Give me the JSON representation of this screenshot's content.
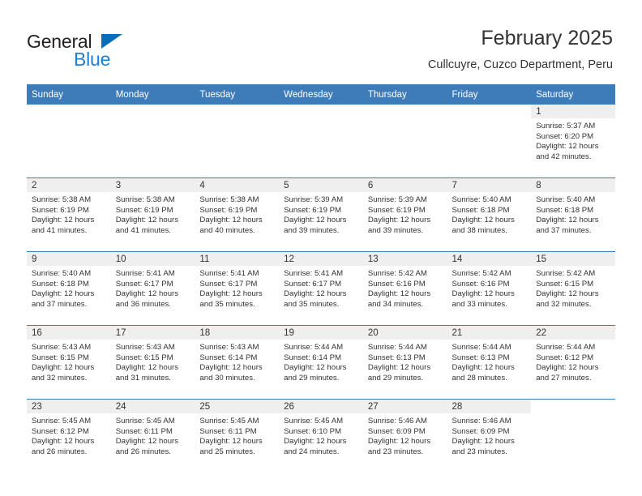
{
  "brand": {
    "name_top": "General",
    "name_bottom": "Blue",
    "triangle_color": "#0b6cb7",
    "blue_text_color": "#1b7fd4"
  },
  "header": {
    "title": "February 2025",
    "subtitle": "Cullcuyre, Cuzco Department, Peru"
  },
  "theme": {
    "header_bg": "#3e7cb9",
    "header_text": "#ffffff",
    "daynum_band_bg": "#efefef",
    "row_divider": "#3e7cb9",
    "body_text": "#333333"
  },
  "calendar": {
    "weekdays": [
      "Sunday",
      "Monday",
      "Tuesday",
      "Wednesday",
      "Thursday",
      "Friday",
      "Saturday"
    ],
    "labels": {
      "sunrise": "Sunrise:",
      "sunset": "Sunset:",
      "daylight": "Daylight:"
    },
    "weeks": [
      [
        {
          "day": "",
          "sunrise": "",
          "sunset": "",
          "daylight_line1": "",
          "daylight_line2": ""
        },
        {
          "day": "",
          "sunrise": "",
          "sunset": "",
          "daylight_line1": "",
          "daylight_line2": ""
        },
        {
          "day": "",
          "sunrise": "",
          "sunset": "",
          "daylight_line1": "",
          "daylight_line2": ""
        },
        {
          "day": "",
          "sunrise": "",
          "sunset": "",
          "daylight_line1": "",
          "daylight_line2": ""
        },
        {
          "day": "",
          "sunrise": "",
          "sunset": "",
          "daylight_line1": "",
          "daylight_line2": ""
        },
        {
          "day": "",
          "sunrise": "",
          "sunset": "",
          "daylight_line1": "",
          "daylight_line2": ""
        },
        {
          "day": "1",
          "sunrise": "Sunrise: 5:37 AM",
          "sunset": "Sunset: 6:20 PM",
          "daylight_line1": "Daylight: 12 hours",
          "daylight_line2": "and 42 minutes."
        }
      ],
      [
        {
          "day": "2",
          "sunrise": "Sunrise: 5:38 AM",
          "sunset": "Sunset: 6:19 PM",
          "daylight_line1": "Daylight: 12 hours",
          "daylight_line2": "and 41 minutes."
        },
        {
          "day": "3",
          "sunrise": "Sunrise: 5:38 AM",
          "sunset": "Sunset: 6:19 PM",
          "daylight_line1": "Daylight: 12 hours",
          "daylight_line2": "and 41 minutes."
        },
        {
          "day": "4",
          "sunrise": "Sunrise: 5:38 AM",
          "sunset": "Sunset: 6:19 PM",
          "daylight_line1": "Daylight: 12 hours",
          "daylight_line2": "and 40 minutes."
        },
        {
          "day": "5",
          "sunrise": "Sunrise: 5:39 AM",
          "sunset": "Sunset: 6:19 PM",
          "daylight_line1": "Daylight: 12 hours",
          "daylight_line2": "and 39 minutes."
        },
        {
          "day": "6",
          "sunrise": "Sunrise: 5:39 AM",
          "sunset": "Sunset: 6:19 PM",
          "daylight_line1": "Daylight: 12 hours",
          "daylight_line2": "and 39 minutes."
        },
        {
          "day": "7",
          "sunrise": "Sunrise: 5:40 AM",
          "sunset": "Sunset: 6:18 PM",
          "daylight_line1": "Daylight: 12 hours",
          "daylight_line2": "and 38 minutes."
        },
        {
          "day": "8",
          "sunrise": "Sunrise: 5:40 AM",
          "sunset": "Sunset: 6:18 PM",
          "daylight_line1": "Daylight: 12 hours",
          "daylight_line2": "and 37 minutes."
        }
      ],
      [
        {
          "day": "9",
          "sunrise": "Sunrise: 5:40 AM",
          "sunset": "Sunset: 6:18 PM",
          "daylight_line1": "Daylight: 12 hours",
          "daylight_line2": "and 37 minutes."
        },
        {
          "day": "10",
          "sunrise": "Sunrise: 5:41 AM",
          "sunset": "Sunset: 6:17 PM",
          "daylight_line1": "Daylight: 12 hours",
          "daylight_line2": "and 36 minutes."
        },
        {
          "day": "11",
          "sunrise": "Sunrise: 5:41 AM",
          "sunset": "Sunset: 6:17 PM",
          "daylight_line1": "Daylight: 12 hours",
          "daylight_line2": "and 35 minutes."
        },
        {
          "day": "12",
          "sunrise": "Sunrise: 5:41 AM",
          "sunset": "Sunset: 6:17 PM",
          "daylight_line1": "Daylight: 12 hours",
          "daylight_line2": "and 35 minutes."
        },
        {
          "day": "13",
          "sunrise": "Sunrise: 5:42 AM",
          "sunset": "Sunset: 6:16 PM",
          "daylight_line1": "Daylight: 12 hours",
          "daylight_line2": "and 34 minutes."
        },
        {
          "day": "14",
          "sunrise": "Sunrise: 5:42 AM",
          "sunset": "Sunset: 6:16 PM",
          "daylight_line1": "Daylight: 12 hours",
          "daylight_line2": "and 33 minutes."
        },
        {
          "day": "15",
          "sunrise": "Sunrise: 5:42 AM",
          "sunset": "Sunset: 6:15 PM",
          "daylight_line1": "Daylight: 12 hours",
          "daylight_line2": "and 32 minutes."
        }
      ],
      [
        {
          "day": "16",
          "sunrise": "Sunrise: 5:43 AM",
          "sunset": "Sunset: 6:15 PM",
          "daylight_line1": "Daylight: 12 hours",
          "daylight_line2": "and 32 minutes."
        },
        {
          "day": "17",
          "sunrise": "Sunrise: 5:43 AM",
          "sunset": "Sunset: 6:15 PM",
          "daylight_line1": "Daylight: 12 hours",
          "daylight_line2": "and 31 minutes."
        },
        {
          "day": "18",
          "sunrise": "Sunrise: 5:43 AM",
          "sunset": "Sunset: 6:14 PM",
          "daylight_line1": "Daylight: 12 hours",
          "daylight_line2": "and 30 minutes."
        },
        {
          "day": "19",
          "sunrise": "Sunrise: 5:44 AM",
          "sunset": "Sunset: 6:14 PM",
          "daylight_line1": "Daylight: 12 hours",
          "daylight_line2": "and 29 minutes."
        },
        {
          "day": "20",
          "sunrise": "Sunrise: 5:44 AM",
          "sunset": "Sunset: 6:13 PM",
          "daylight_line1": "Daylight: 12 hours",
          "daylight_line2": "and 29 minutes."
        },
        {
          "day": "21",
          "sunrise": "Sunrise: 5:44 AM",
          "sunset": "Sunset: 6:13 PM",
          "daylight_line1": "Daylight: 12 hours",
          "daylight_line2": "and 28 minutes."
        },
        {
          "day": "22",
          "sunrise": "Sunrise: 5:44 AM",
          "sunset": "Sunset: 6:12 PM",
          "daylight_line1": "Daylight: 12 hours",
          "daylight_line2": "and 27 minutes."
        }
      ],
      [
        {
          "day": "23",
          "sunrise": "Sunrise: 5:45 AM",
          "sunset": "Sunset: 6:12 PM",
          "daylight_line1": "Daylight: 12 hours",
          "daylight_line2": "and 26 minutes."
        },
        {
          "day": "24",
          "sunrise": "Sunrise: 5:45 AM",
          "sunset": "Sunset: 6:11 PM",
          "daylight_line1": "Daylight: 12 hours",
          "daylight_line2": "and 26 minutes."
        },
        {
          "day": "25",
          "sunrise": "Sunrise: 5:45 AM",
          "sunset": "Sunset: 6:11 PM",
          "daylight_line1": "Daylight: 12 hours",
          "daylight_line2": "and 25 minutes."
        },
        {
          "day": "26",
          "sunrise": "Sunrise: 5:45 AM",
          "sunset": "Sunset: 6:10 PM",
          "daylight_line1": "Daylight: 12 hours",
          "daylight_line2": "and 24 minutes."
        },
        {
          "day": "27",
          "sunrise": "Sunrise: 5:46 AM",
          "sunset": "Sunset: 6:09 PM",
          "daylight_line1": "Daylight: 12 hours",
          "daylight_line2": "and 23 minutes."
        },
        {
          "day": "28",
          "sunrise": "Sunrise: 5:46 AM",
          "sunset": "Sunset: 6:09 PM",
          "daylight_line1": "Daylight: 12 hours",
          "daylight_line2": "and 23 minutes."
        },
        {
          "day": "",
          "sunrise": "",
          "sunset": "",
          "daylight_line1": "",
          "daylight_line2": ""
        }
      ]
    ]
  }
}
